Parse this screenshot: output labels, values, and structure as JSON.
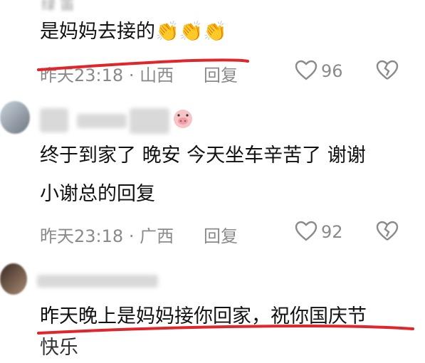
{
  "comments": [
    {
      "username": "绿 笛",
      "text": "是妈妈去接的👏👏👏",
      "time": "昨天23:18",
      "location": "山西",
      "reply_label": "回复",
      "likes": "96"
    },
    {
      "text_line1": "终于到家了 晚安 今天坐车辛苦了 谢谢",
      "text_line2": "小谢总的回复",
      "time": "昨天23:18",
      "location": "广西",
      "reply_label": "回复",
      "likes": "92"
    },
    {
      "text": "昨天晚上是妈妈接你回家，祝你国庆节",
      "text_partial": "快乐"
    }
  ],
  "separator": "·",
  "colors": {
    "annotation": "#e0262a",
    "meta": "#8a8a8a"
  },
  "icons": [
    "heart-icon",
    "broken-heart-icon",
    "pig-emoji-icon",
    "clap-emoji-icon"
  ]
}
